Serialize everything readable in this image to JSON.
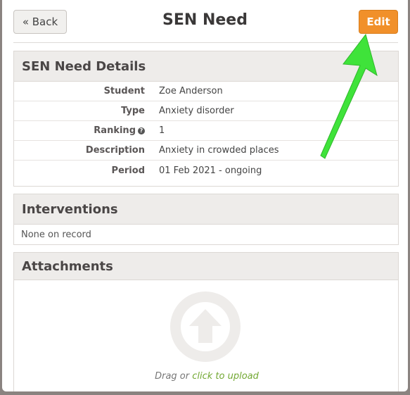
{
  "header": {
    "back_label": "« Back",
    "title": "SEN Need",
    "edit_label": "Edit"
  },
  "details": {
    "heading": "SEN Need Details",
    "rows": [
      {
        "label": "Student",
        "value": "Zoe Anderson"
      },
      {
        "label": "Type",
        "value": "Anxiety disorder"
      },
      {
        "label": "Ranking",
        "value": "1"
      },
      {
        "label": "Description",
        "value": "Anxiety in crowded places"
      },
      {
        "label": "Period",
        "value": "01 Feb 2021 - ongoing"
      }
    ]
  },
  "interventions": {
    "heading": "Interventions",
    "empty_text": "None on record"
  },
  "attachments": {
    "heading": "Attachments",
    "drag_text": "Drag or",
    "upload_link": "click to upload"
  },
  "colors": {
    "edit_button": "#f1902a",
    "annotation_arrow": "#3fe33a",
    "upload_link": "#72a832"
  }
}
